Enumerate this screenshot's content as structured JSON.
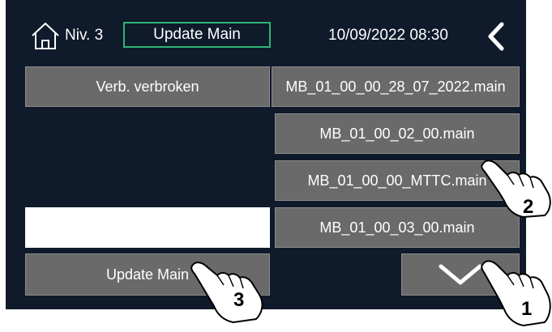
{
  "header": {
    "level": "Niv. 3",
    "title": "Update Main",
    "datetime": "10/09/2022 08:30",
    "home_icon": "home-icon",
    "back_icon": "chevron-left-icon"
  },
  "status_button": {
    "label": "Verb. verbroken"
  },
  "files": [
    "MB_01_00_00_28_07_2022.main",
    "MB_01_00_02_00.main",
    "MB_01_00_00_MTTC.main",
    "MB_01_00_03_00.main"
  ],
  "update_button": {
    "label": "Update Main"
  },
  "down_button": {
    "icon": "chevron-down-icon"
  },
  "annotations": {
    "step1": "1",
    "step2": "2",
    "step3": "3"
  },
  "colors": {
    "screen_bg": "#0f1a2b",
    "button_bg": "#6a6a6a",
    "title_border": "#2fb374"
  }
}
